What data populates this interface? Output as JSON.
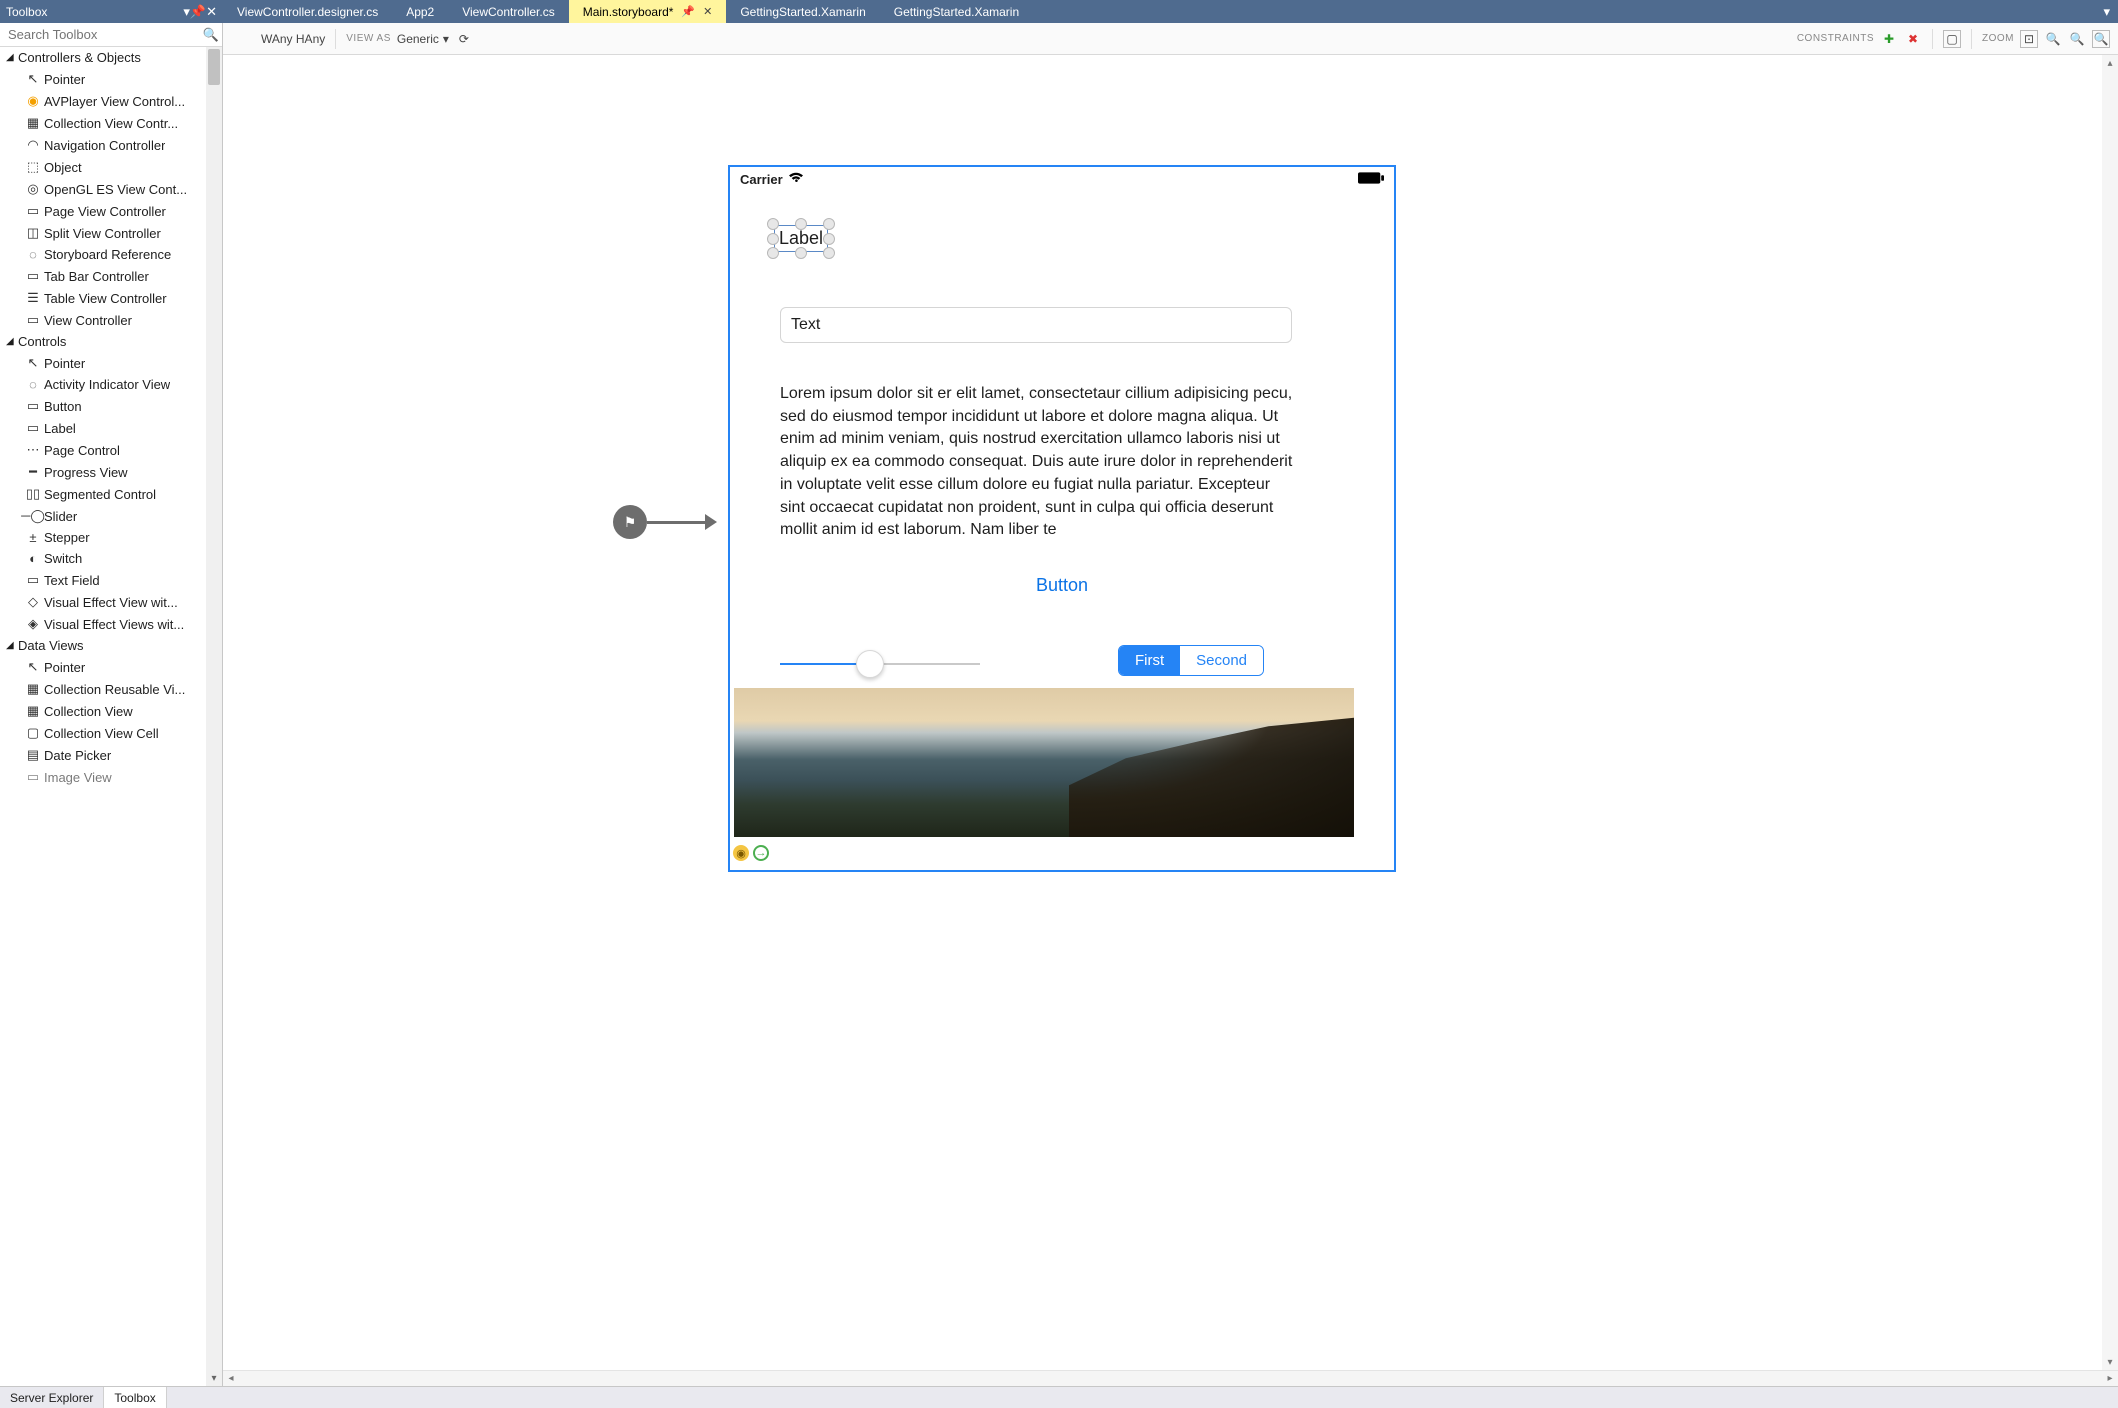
{
  "toolbox": {
    "title": "Toolbox",
    "search_placeholder": "Search Toolbox",
    "categories": [
      {
        "name": "Controllers & Objects",
        "items": [
          "Pointer",
          "AVPlayer View Control...",
          "Collection View Contr...",
          "Navigation Controller",
          "Object",
          "OpenGL ES View Cont...",
          "Page View Controller",
          "Split View Controller",
          "Storyboard Reference",
          "Tab Bar Controller",
          "Table View Controller",
          "View Controller"
        ]
      },
      {
        "name": "Controls",
        "items": [
          "Pointer",
          "Activity Indicator View",
          "Button",
          "Label",
          "Page Control",
          "Progress View",
          "Segmented Control",
          "Slider",
          "Stepper",
          "Switch",
          "Text Field",
          "Visual Effect View wit...",
          "Visual Effect Views wit..."
        ]
      },
      {
        "name": "Data Views",
        "items": [
          "Pointer",
          "Collection Reusable Vi...",
          "Collection View",
          "Collection View Cell",
          "Date Picker",
          "Image View"
        ]
      }
    ]
  },
  "tabs": [
    "ViewController.designer.cs",
    "App2",
    "ViewController.cs",
    "Main.storyboard*",
    "GettingStarted.Xamarin",
    "GettingStarted.Xamarin"
  ],
  "active_tab_index": 3,
  "designer_toolbar": {
    "size_hint": "WAny HAny",
    "viewas_label": "VIEW AS",
    "device": "Generic",
    "constraints_label": "CONSTRAINTS",
    "zoom_label": "ZOOM"
  },
  "storyboard": {
    "carrier": "Carrier",
    "selected_label": "Label",
    "textfield_value": "Text",
    "lorem": "Lorem ipsum dolor sit er elit lamet, consectetaur cillium adipisicing pecu, sed do eiusmod tempor incididunt ut labore et dolore magna aliqua. Ut enim ad minim veniam, quis nostrud exercitation ullamco laboris nisi ut aliquip ex ea commodo consequat. Duis aute irure dolor in reprehenderit in voluptate velit esse cillum dolore eu fugiat nulla pariatur. Excepteur sint occaecat cupidatat non proident, sunt in culpa qui officia deserunt mollit anim id est laborum. Nam liber te",
    "button_label": "Button",
    "segments": [
      "First",
      "Second"
    ],
    "segment_selected": 0
  },
  "bottom_tabs": [
    "Server Explorer",
    "Toolbox"
  ],
  "bottom_active": 1
}
